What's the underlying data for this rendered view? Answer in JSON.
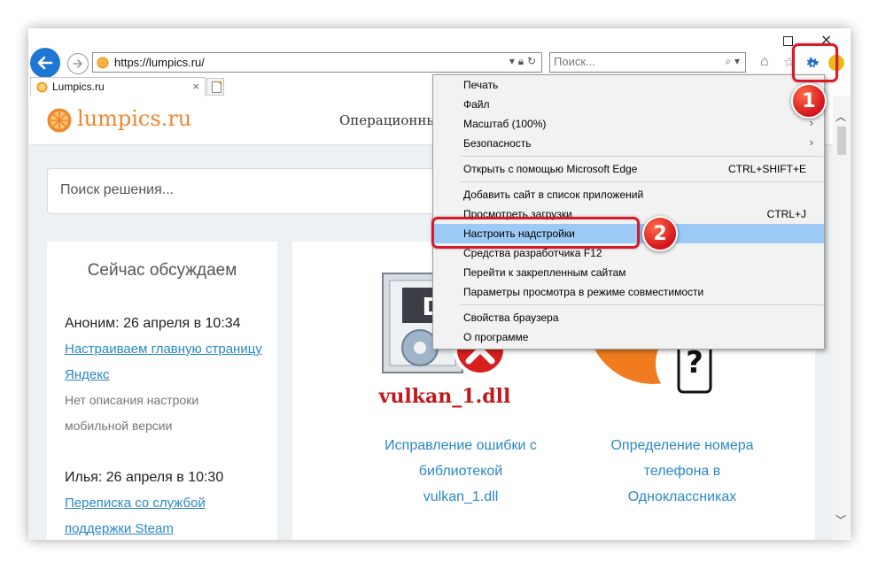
{
  "browser": {
    "address_url": "https://lumpics.ru/",
    "search_placeholder": "Поиск...",
    "tab_label": "Lumpics.ru",
    "tab_close": "×"
  },
  "site": {
    "name": "lumpics.ru",
    "nav_item": "Операционны",
    "search_placeholder": "Поиск решения...",
    "sidebar": {
      "title": "Сейчас обсуждаем",
      "comments": [
        {
          "author": "Аноним: 26 апреля в 10:34",
          "link_line1": "Настраиваем главную страницу",
          "link_line2": "Яндекс",
          "desc_line1": "Нет описания настроки",
          "desc_line2": "мобильной версии"
        },
        {
          "author": "Илья: 26 апреля в 10:30",
          "link_line1": "Переписка со службой",
          "link_line2": "поддержки Steam"
        }
      ]
    },
    "articles": [
      {
        "image_caption": "vulkan_1.dll",
        "title_lines": [
          "Исправление ошибки с",
          "библиотекой",
          "vulkan_1.dll"
        ]
      },
      {
        "title_lines": [
          "Определение номера",
          "телефона в",
          "Одноклассниках"
        ]
      }
    ]
  },
  "menu": {
    "items": [
      {
        "label": "Печать",
        "shortcut": ""
      },
      {
        "label": "Файл",
        "shortcut": ""
      },
      {
        "label": "Масштаб (100%)",
        "shortcut": ""
      },
      {
        "label": "Безопасность",
        "shortcut": ""
      },
      {
        "label": "Открыть с помощью Microsoft Edge",
        "shortcut": "CTRL+SHIFT+E"
      },
      {
        "label": "Добавить сайт в список приложений",
        "shortcut": ""
      },
      {
        "label": "Просмотреть загрузки",
        "shortcut": "CTRL+J"
      },
      {
        "label": "Настроить надстройки",
        "shortcut": ""
      },
      {
        "label": "Средства разработчика F12",
        "shortcut": ""
      },
      {
        "label": "Перейти к закрепленным сайтам",
        "shortcut": ""
      },
      {
        "label": "Параметры просмотра в режиме совместимости",
        "shortcut": ""
      },
      {
        "label": "Свойства браузера",
        "shortcut": ""
      },
      {
        "label": "О программе",
        "shortcut": ""
      }
    ],
    "submenu_arrow": "›"
  },
  "callouts": {
    "badge_1": "1",
    "badge_2": "2"
  },
  "colors": {
    "accent": "#f0862e",
    "link": "#2a88c8",
    "callout": "#d8192a",
    "menu_highlight": "#9cc9f5"
  }
}
